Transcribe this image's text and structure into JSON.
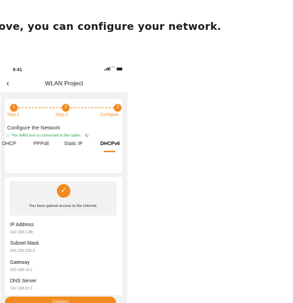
{
  "headline": "ove, you can configure your network.",
  "status": {
    "time": "9:41"
  },
  "nav": {
    "title": "WLAN Project"
  },
  "steps": [
    {
      "number": "1",
      "label": "Step 1"
    },
    {
      "number": "2",
      "label": "Step 2"
    },
    {
      "number": "3",
      "label": "Configure"
    }
  ],
  "config": {
    "title": "Configure the Network",
    "wan_note": "The WAN port is connected to the cable."
  },
  "tabs": [
    {
      "label": "DHCP"
    },
    {
      "label": "PPPoE"
    },
    {
      "label": "Static IP"
    },
    {
      "label": "DHCPv6",
      "active": true
    }
  ],
  "success_message": "You have gained access to the Internet.",
  "fields": [
    {
      "label": "IP Address",
      "value": "192.168.1.88"
    },
    {
      "label": "Subnet Mask",
      "value": "255.255.255.0"
    },
    {
      "label": "Gateway",
      "value": "192.168.10.1"
    },
    {
      "label": "DNS Server",
      "value": "192.168.12.1"
    }
  ],
  "connect_label": "Connect",
  "colors": {
    "accent": "#f28a1e",
    "success": "#28a745",
    "link": "#2f7fd8"
  }
}
